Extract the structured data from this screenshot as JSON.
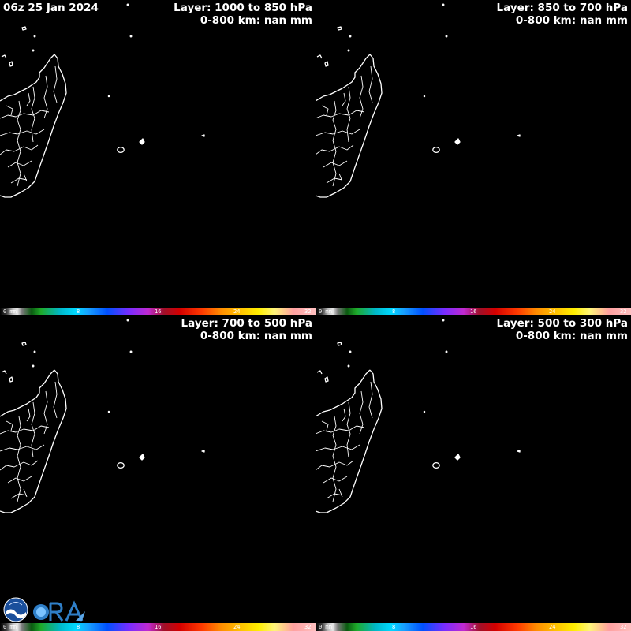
{
  "timestamp": "06z 25 Jan 2024",
  "panels": [
    {
      "layer": "Layer: 1000 to 850 hPa",
      "stat": "0-800 km: nan mm"
    },
    {
      "layer": "Layer: 850 to 700 hPa",
      "stat": "0-800 km: nan mm"
    },
    {
      "layer": "Layer: 700 to 500 hPa",
      "stat": "0-800 km: nan mm"
    },
    {
      "layer": "Layer: 500 to 300 hPa",
      "stat": "0-800 km: nan mm"
    }
  ],
  "colorbar": {
    "ticks": [
      "0 mm",
      "8",
      "16",
      "24",
      "32"
    ],
    "tick_values": [
      0,
      8,
      16,
      24,
      32
    ],
    "min": 0,
    "max": 32,
    "unit": "mm"
  },
  "logos": [
    "noaa-logo",
    "cira-logo"
  ],
  "colors": {
    "background": "#000000",
    "coastline": "#ffffff",
    "text": "#ffffff"
  }
}
